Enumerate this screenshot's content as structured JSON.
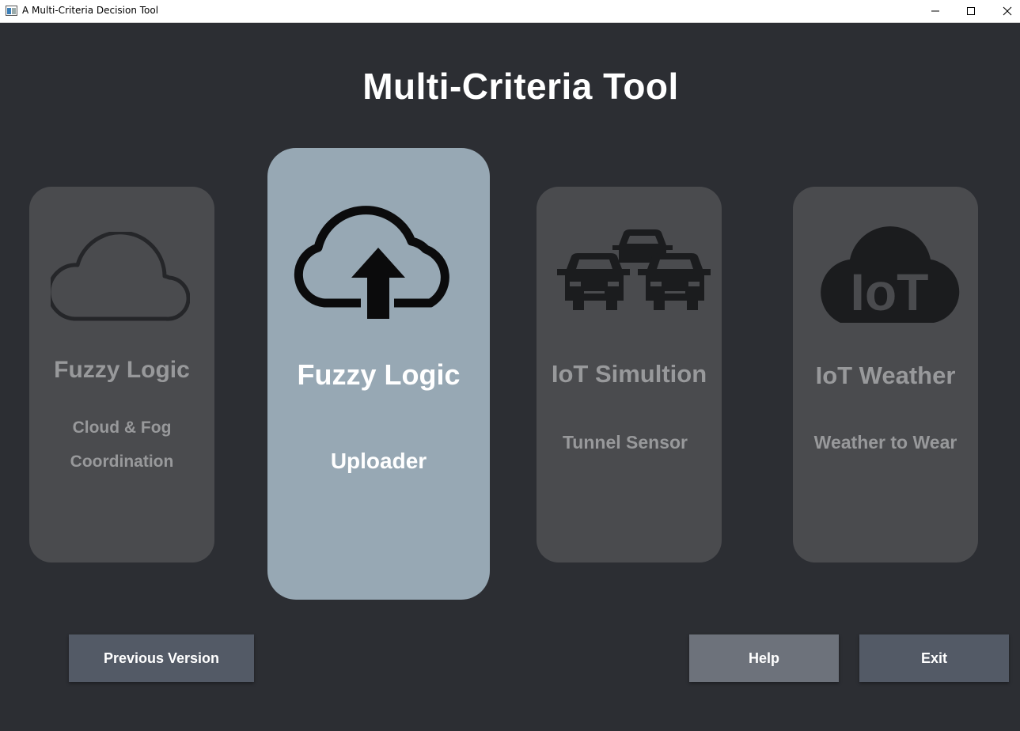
{
  "window": {
    "title": "A Multi-Criteria Decision Tool",
    "controls": [
      "minimize",
      "maximize",
      "close"
    ]
  },
  "page": {
    "title": "Multi-Criteria Tool"
  },
  "cards": [
    {
      "title": "Fuzzy Logic",
      "subtitle_line1": "Cloud & Fog",
      "subtitle_line2": "Coordination",
      "icon": "cloud-outline-icon",
      "selected": false
    },
    {
      "title": "Fuzzy Logic",
      "subtitle": "Uploader",
      "icon": "cloud-upload-icon",
      "selected": true
    },
    {
      "title": "IoT Simultion",
      "subtitle": "Tunnel Sensor",
      "icon": "traffic-cars-icon",
      "selected": false
    },
    {
      "title": "IoT Weather",
      "subtitle": "Weather to Wear",
      "icon": "iot-cloud-icon",
      "icon_text": "IoT",
      "selected": false
    }
  ],
  "buttons": {
    "previous_version": "Previous Version",
    "help": "Help",
    "exit": "Exit"
  },
  "colors": {
    "background": "#2c2e33",
    "card": "#4a4b4e",
    "card_selected": "#97a8b4",
    "card_text": "#98999b",
    "button": "#535a66",
    "button_help": "#6d727b"
  }
}
